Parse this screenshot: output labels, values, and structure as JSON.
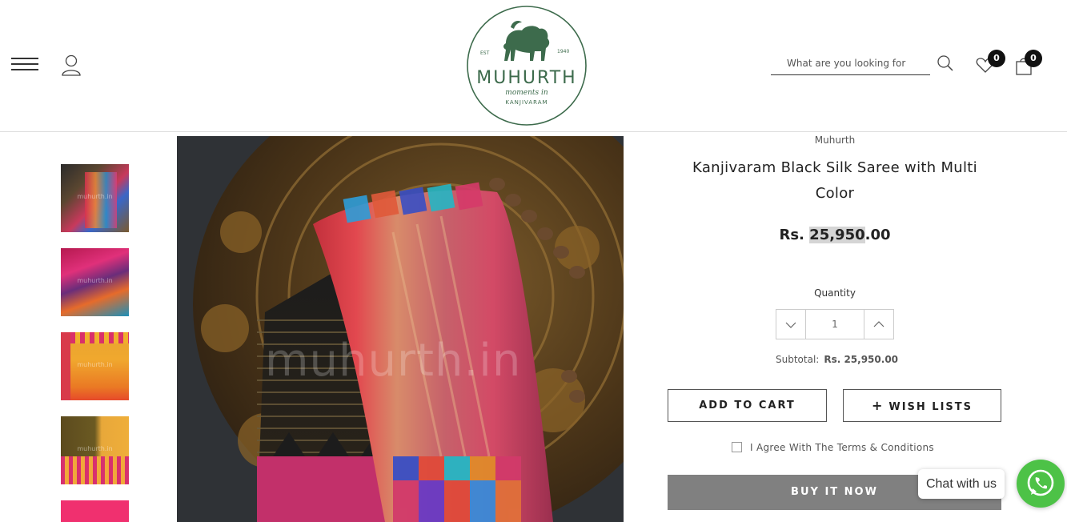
{
  "header": {
    "logo": {
      "brand": "MUHURTH",
      "tagline": "moments in",
      "sub": "KANJIVARAM",
      "est_label": "EST",
      "year": "1940"
    },
    "search": {
      "placeholder": "What are you looking for"
    },
    "wishlist_count": "0",
    "cart_count": "0"
  },
  "gallery": {
    "thumbnail_labels": [
      "muhurth.in",
      "muhurth.in",
      "muhurth.in",
      "muhurth.in"
    ],
    "watermark": "muhurth.in"
  },
  "product": {
    "brand": "Muhurth",
    "title": "Kanjivaram Black Silk Saree with Multi Color",
    "price_prefix": "Rs.",
    "price_highlight": "25,950",
    "price_suffix": ".00",
    "quantity_label": "Quantity",
    "quantity_value": "1",
    "subtotal_label": "Subtotal:",
    "subtotal_value": "Rs. 25,950.00"
  },
  "actions": {
    "add_to_cart": "ADD TO CART",
    "wish_lists": "WISH LISTS",
    "plus": "+",
    "agree_terms": "I Agree With The Terms & Conditions",
    "buy_now": "BUY IT NOW"
  },
  "chat": {
    "label": "Chat with us"
  },
  "colors": {
    "buy_button": "#808080",
    "whatsapp": "#4dc247",
    "logo_green": "#3d6b4c"
  }
}
